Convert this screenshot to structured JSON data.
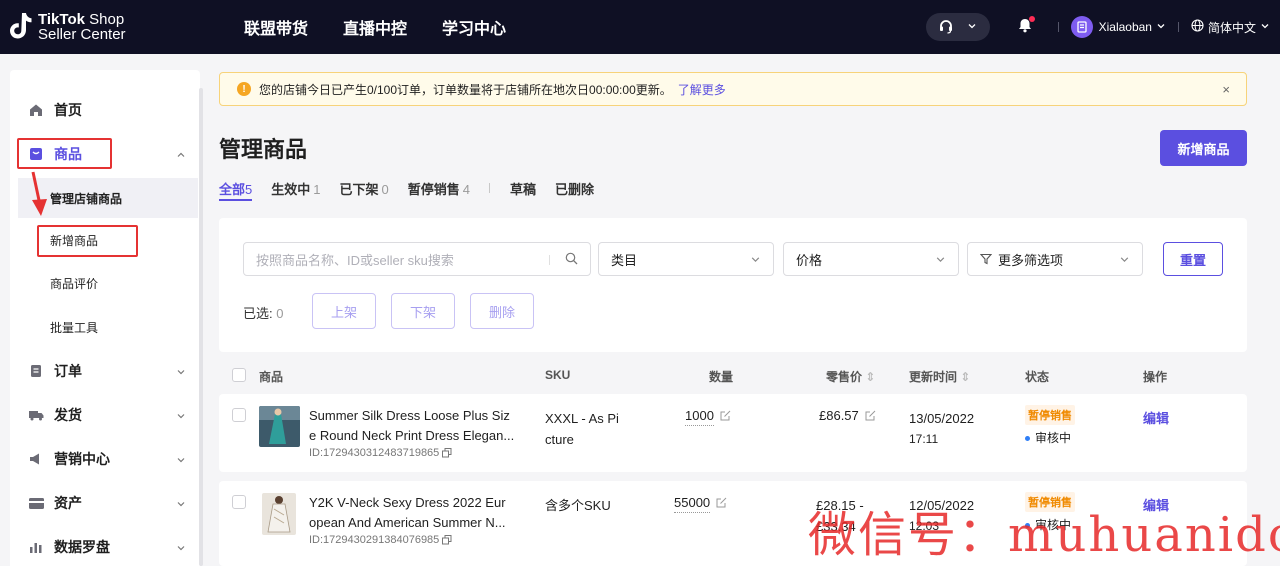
{
  "logo": {
    "brand": "TikTok",
    "shop": " Shop",
    "sub": "Seller Center"
  },
  "topnav": [
    "联盟带货",
    "直播中控",
    "学习中心"
  ],
  "topright": {
    "user": "Xialaoban",
    "lang": "简体中文"
  },
  "sidebar": {
    "home": "首页",
    "products": "商品",
    "products_sub": [
      "管理店铺商品",
      "新增商品",
      "商品评价",
      "批量工具"
    ],
    "orders": "订单",
    "shipping": "发货",
    "marketing": "营销中心",
    "assets": "资产",
    "compass": "数据罗盘"
  },
  "banner": {
    "text": "您的店铺今日已产生0/100订单，订单数量将于店铺所在地次日00:00:00更新。",
    "link": "了解更多",
    "close": "×"
  },
  "page": {
    "title": "管理商品",
    "new_button": "新增商品"
  },
  "tabs": [
    {
      "label": "全部",
      "count": "5"
    },
    {
      "label": "生效中",
      "count": "1"
    },
    {
      "label": "已下架",
      "count": "0"
    },
    {
      "label": "暂停销售",
      "count": "4"
    },
    {
      "label": "草稿",
      "count": ""
    },
    {
      "label": "已删除",
      "count": ""
    }
  ],
  "filters": {
    "search_placeholder": "按照商品名称、ID或seller sku搜索",
    "category": "类目",
    "price": "价格",
    "more": "更多筛选项",
    "reset": "重置",
    "selected_label": "已选:",
    "selected_count": "0",
    "btn_list": "上架",
    "btn_delist": "下架",
    "btn_delete": "删除"
  },
  "table": {
    "headers": {
      "product": "商品",
      "sku": "SKU",
      "qty": "数量",
      "price": "零售价",
      "updated": "更新时间",
      "status": "状态",
      "action": "操作"
    },
    "rows": [
      {
        "name1": "Summer Silk Dress Loose Plus Siz",
        "name2": "e Round Neck Print Dress Elegan...",
        "id": "ID:1729430312483719865",
        "sku1": "XXXL - As Pi",
        "sku2": "cture",
        "qty": "1000",
        "price1": "£86.57",
        "price2": "",
        "date": "13/05/2022",
        "time": "17:11",
        "status": "暂停销售",
        "review": "审核中",
        "action": "编辑"
      },
      {
        "name1": "Y2K V-Neck Sexy Dress 2022 Eur",
        "name2": "opean And American Summer N...",
        "id": "ID:1729430291384076985",
        "sku1": "含多个SKU",
        "sku2": "",
        "qty": "55000",
        "price1": "£28.15 -",
        "price2": "£33.34",
        "date": "12/05/2022",
        "time": "12:03",
        "status": "暂停销售",
        "review": "审核中",
        "action": "编辑"
      }
    ]
  },
  "watermark": "微信号：muhuanidc",
  "colors": {
    "accent": "#5b4fe0",
    "topbar": "#0f1024",
    "warn": "#f5a623",
    "highlight": "#e53232"
  }
}
